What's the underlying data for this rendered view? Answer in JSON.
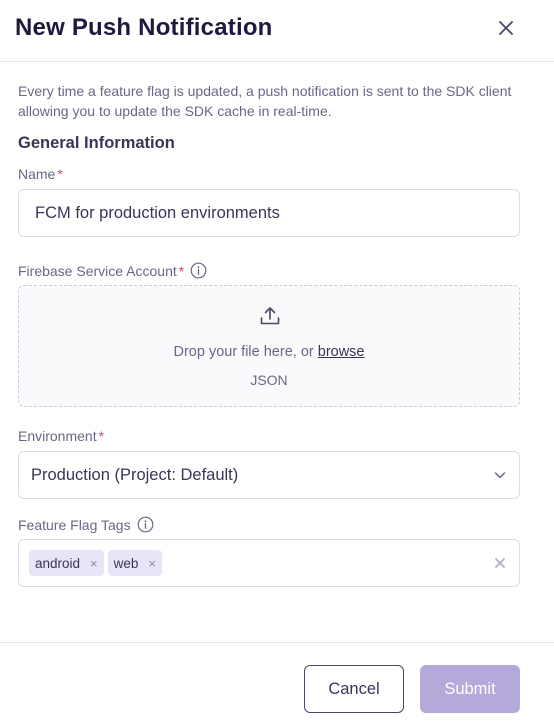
{
  "dialog": {
    "title": "New Push Notification",
    "close_icon": "close-icon",
    "description": "Every time a feature flag is updated, a push notification is sent to the SDK client allowing you to update the SDK cache in real-time."
  },
  "general": {
    "section_title": "General Information",
    "name": {
      "label": "Name",
      "required_mark": "*",
      "value": "FCM for production environments"
    },
    "service_account": {
      "label": "Firebase Service Account",
      "required_mark": "*",
      "info_icon": "info-icon",
      "upload_icon": "upload-icon",
      "drop_text": "Drop your file here, or ",
      "browse_label": "browse",
      "file_type": "JSON"
    },
    "environment": {
      "label": "Environment",
      "required_mark": "*",
      "selected": "Production (Project: Default)",
      "chevron_icon": "chevron-down-icon"
    },
    "tags": {
      "label": "Feature Flag Tags",
      "info_icon": "info-icon",
      "items": [
        {
          "label": "android",
          "remove": "×"
        },
        {
          "label": "web",
          "remove": "×"
        }
      ],
      "clear_icon": "clear-icon"
    }
  },
  "footer": {
    "cancel_label": "Cancel",
    "submit_label": "Submit"
  },
  "colors": {
    "required": "#e04660",
    "tag_background": "#e8e5f8",
    "submit_disabled": "#b4a9d9",
    "cancel_border": "#4d4570"
  }
}
